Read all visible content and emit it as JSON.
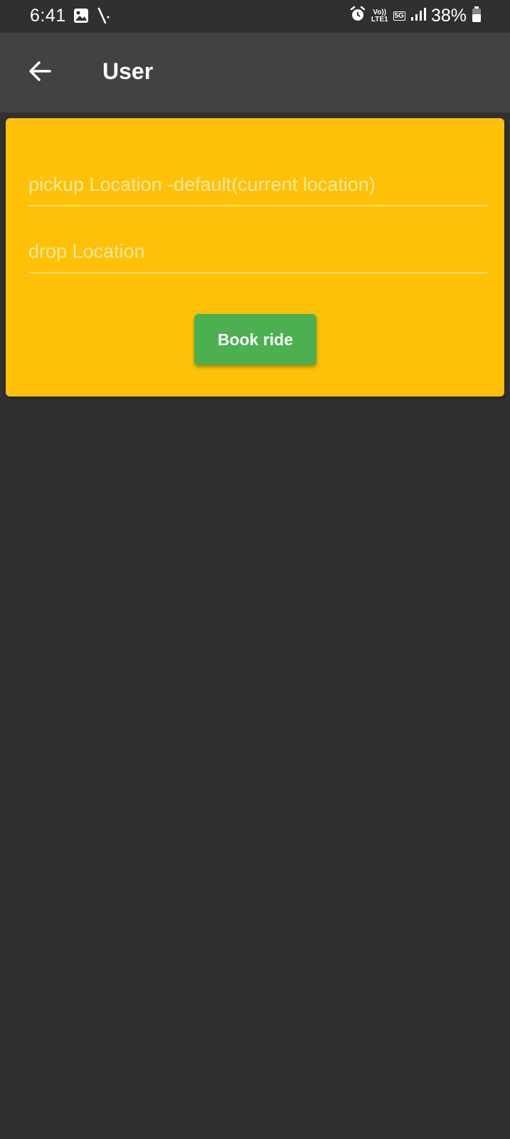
{
  "status_bar": {
    "time": "6:41",
    "battery": "38%",
    "network_top": "Vo))",
    "network_bottom": "LTE1",
    "network_type": "5G",
    "icons": [
      "gallery-icon",
      "signal-stroke-icon",
      "alarm-icon",
      "signal-bars-icon",
      "battery-icon"
    ]
  },
  "app_bar": {
    "title": "User",
    "back_icon": "arrow-left-icon"
  },
  "form": {
    "pickup_placeholder": "pickup Location -default(current location)",
    "pickup_value": "",
    "drop_placeholder": "drop Location",
    "drop_value": "",
    "book_label": "Book ride"
  },
  "colors": {
    "background": "#303030",
    "app_bar": "#424242",
    "card": "#ffc107",
    "button": "#4caf50",
    "text": "#ffffff"
  }
}
